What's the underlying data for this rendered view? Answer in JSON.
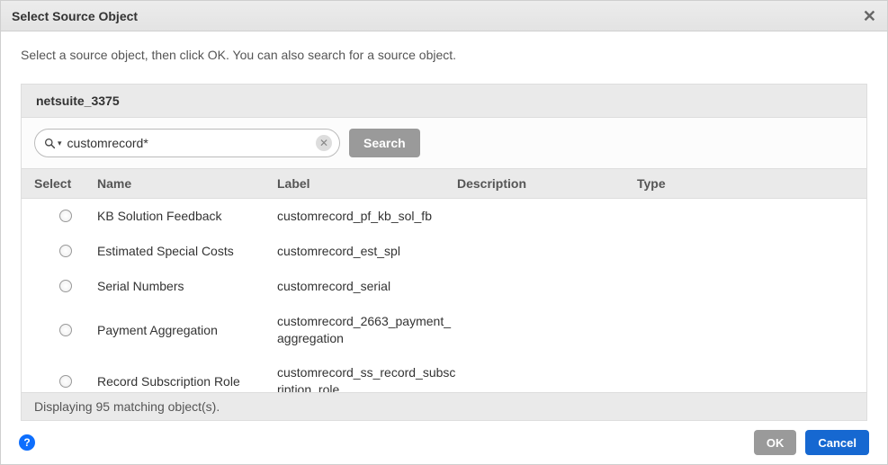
{
  "dialog": {
    "title": "Select Source Object",
    "instructions": "Select a source object, then click OK. You can also search for a source object."
  },
  "panel": {
    "header": "netsuite_3375"
  },
  "search": {
    "value": "customrecord*",
    "placeholder": "",
    "button_label": "Search"
  },
  "columns": {
    "select": "Select",
    "name": "Name",
    "label": "Label",
    "description": "Description",
    "type": "Type"
  },
  "rows": [
    {
      "name": "KB Solution Feedback",
      "label": "customrecord_pf_kb_sol_fb",
      "description": "",
      "type": ""
    },
    {
      "name": "Estimated Special Costs",
      "label": "customrecord_est_spl",
      "description": "",
      "type": ""
    },
    {
      "name": "Serial Numbers",
      "label": "customrecord_serial",
      "description": "",
      "type": ""
    },
    {
      "name": "Payment Aggregation",
      "label": "customrecord_2663_payment_aggregation",
      "description": "",
      "type": ""
    },
    {
      "name": "Record Subscription Role",
      "label": "customrecord_ss_record_subscription_role",
      "description": "",
      "type": ""
    }
  ],
  "status": {
    "text": "Displaying 95 matching object(s)."
  },
  "footer": {
    "ok_label": "OK",
    "cancel_label": "Cancel"
  }
}
